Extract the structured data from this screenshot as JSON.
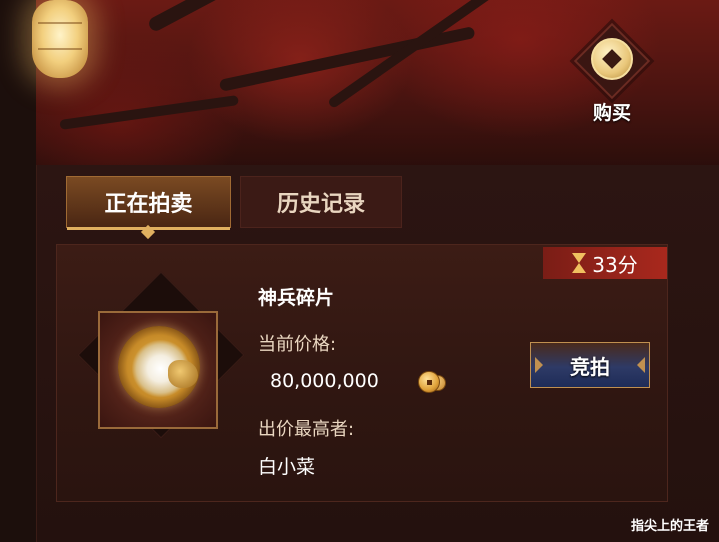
{
  "header": {
    "buy_label": "购买"
  },
  "tabs": [
    {
      "label": "正在拍卖",
      "active": true
    },
    {
      "label": "历史记录",
      "active": false
    }
  ],
  "auction": {
    "timer": "33分",
    "item_name": "神兵碎片",
    "price_label": "当前价格:",
    "price": "80,000,000",
    "currency_icon": "copper-coin-icon",
    "highest_bidder_label": "出价最高者:",
    "highest_bidder": "白小菜",
    "bid_button": "竞拍"
  },
  "watermark": "指尖上的王者",
  "colors": {
    "accent_gold": "#e0b060",
    "timer_red": "#a9281d",
    "bid_button_blue": "#1e2c58"
  }
}
